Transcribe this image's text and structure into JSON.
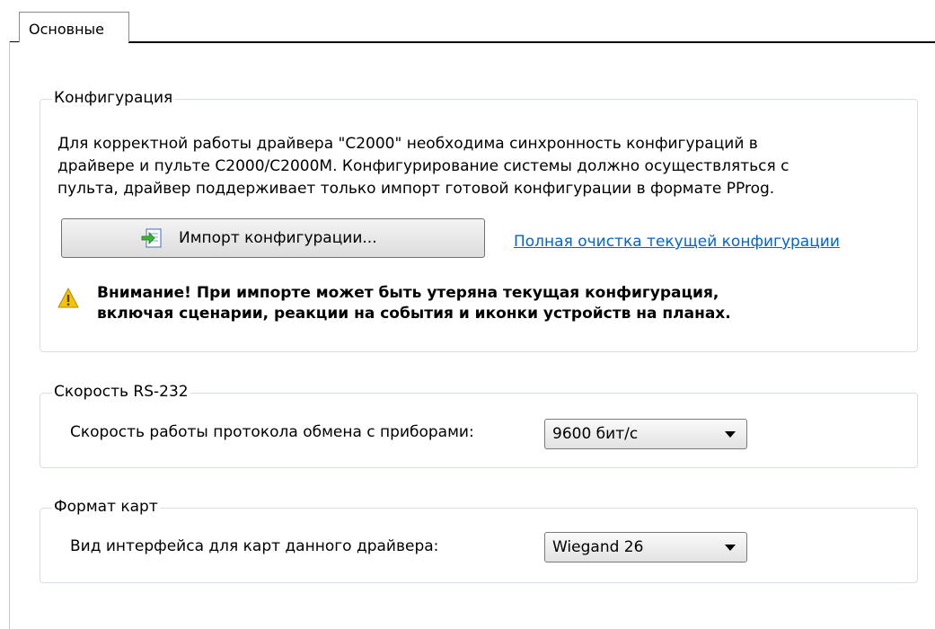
{
  "tabs": [
    {
      "label": "Основные",
      "active": true
    }
  ],
  "config": {
    "title": "Конфигурация",
    "description": [
      "Для корректной работы драйвера \"С2000\" необходима синхронность конфигураций в",
      "драйвере и пульте С2000/С2000М. Конфигурирование системы должно осуществляться с",
      "пульта, драйвер поддерживает только импорт готовой конфигурации в формате PProg."
    ],
    "import_button": "Импорт конфигурации...",
    "clear_link": "Полная очистка текущей конфигурации",
    "warning": [
      "Внимание! При импорте может быть утеряна текущая конфигурация,",
      "включая сценарии, реакции на события и иконки устройств на планах."
    ]
  },
  "rs232": {
    "title": "Скорость RS-232",
    "label": "Скорость работы протокола обмена с приборами:",
    "selected": "9600 бит/с"
  },
  "cards": {
    "title": "Формат карт",
    "label": "Вид интерфейса для карт данного драйвера:",
    "selected": "Wiegand 26"
  },
  "colors": {
    "link": "#0066cc",
    "group_border": "#d5dfe5",
    "warning_icon": "#f5c400"
  }
}
